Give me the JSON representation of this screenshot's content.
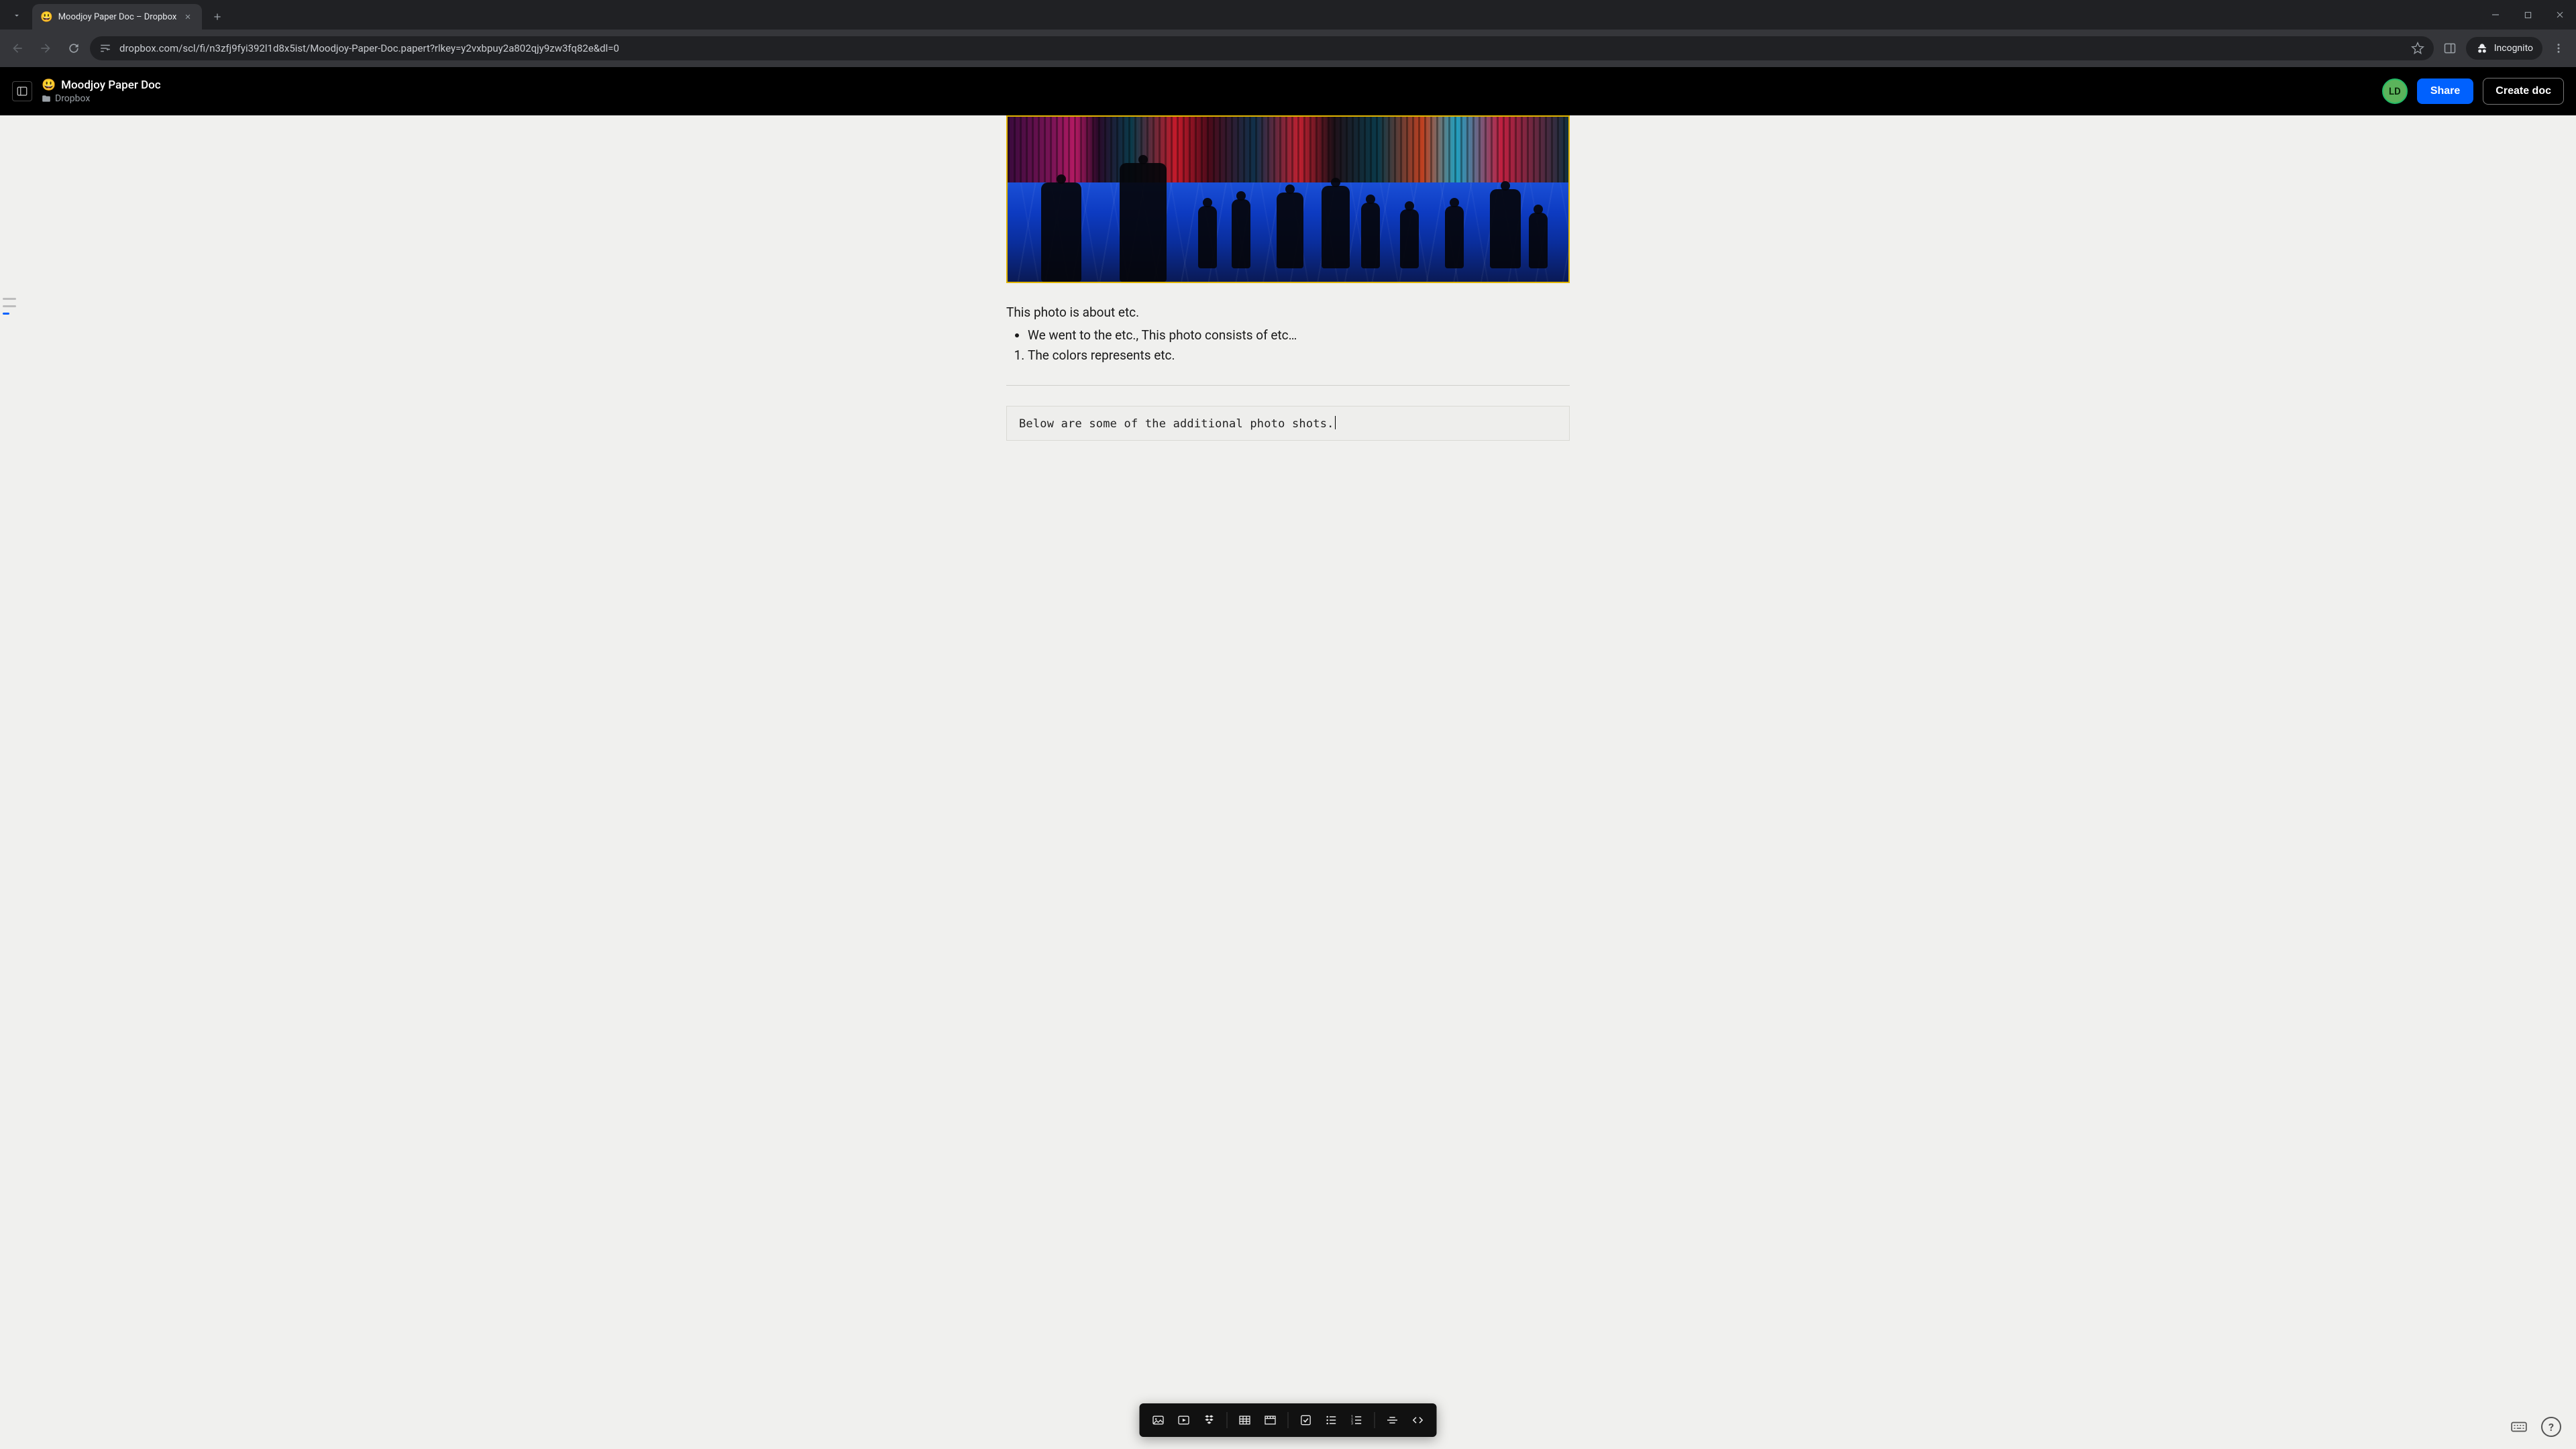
{
  "browser": {
    "tab_title": "Moodjoy Paper Doc – Dropbox",
    "tab_emoji": "😃",
    "url": "dropbox.com/scl/fi/n3zfj9fyi392l1d8x5ist/Moodjoy-Paper-Doc.papert?rlkey=y2vxbpuy2a802qjy9zw3fq82e&dl=0",
    "incognito_label": "Incognito"
  },
  "app_bar": {
    "doc_emoji": "😃",
    "doc_title": "Moodjoy Paper Doc",
    "breadcrumb": "Dropbox",
    "avatar_initials": "LD",
    "share_label": "Share",
    "create_label": "Create doc"
  },
  "document": {
    "image_alt": "Night-time crowd scene with neon-lit storefronts and a blue illuminated floor; silhouettes of people standing and walking.",
    "paragraph": "This photo is about etc.",
    "bullet_item": "We went to the etc., This photo consists of etc…",
    "numbered_item": "The colors represents etc.",
    "code_text": "Below are some of the additional photo shots."
  },
  "insert_toolbar": {
    "items": [
      "image",
      "video",
      "dropbox",
      "table",
      "timeline",
      "checklist",
      "bulleted-list",
      "numbered-list",
      "divider",
      "code"
    ]
  },
  "bottom_right": {
    "keyboard_tip": "Keyboard shortcuts",
    "help_tip": "Help"
  }
}
